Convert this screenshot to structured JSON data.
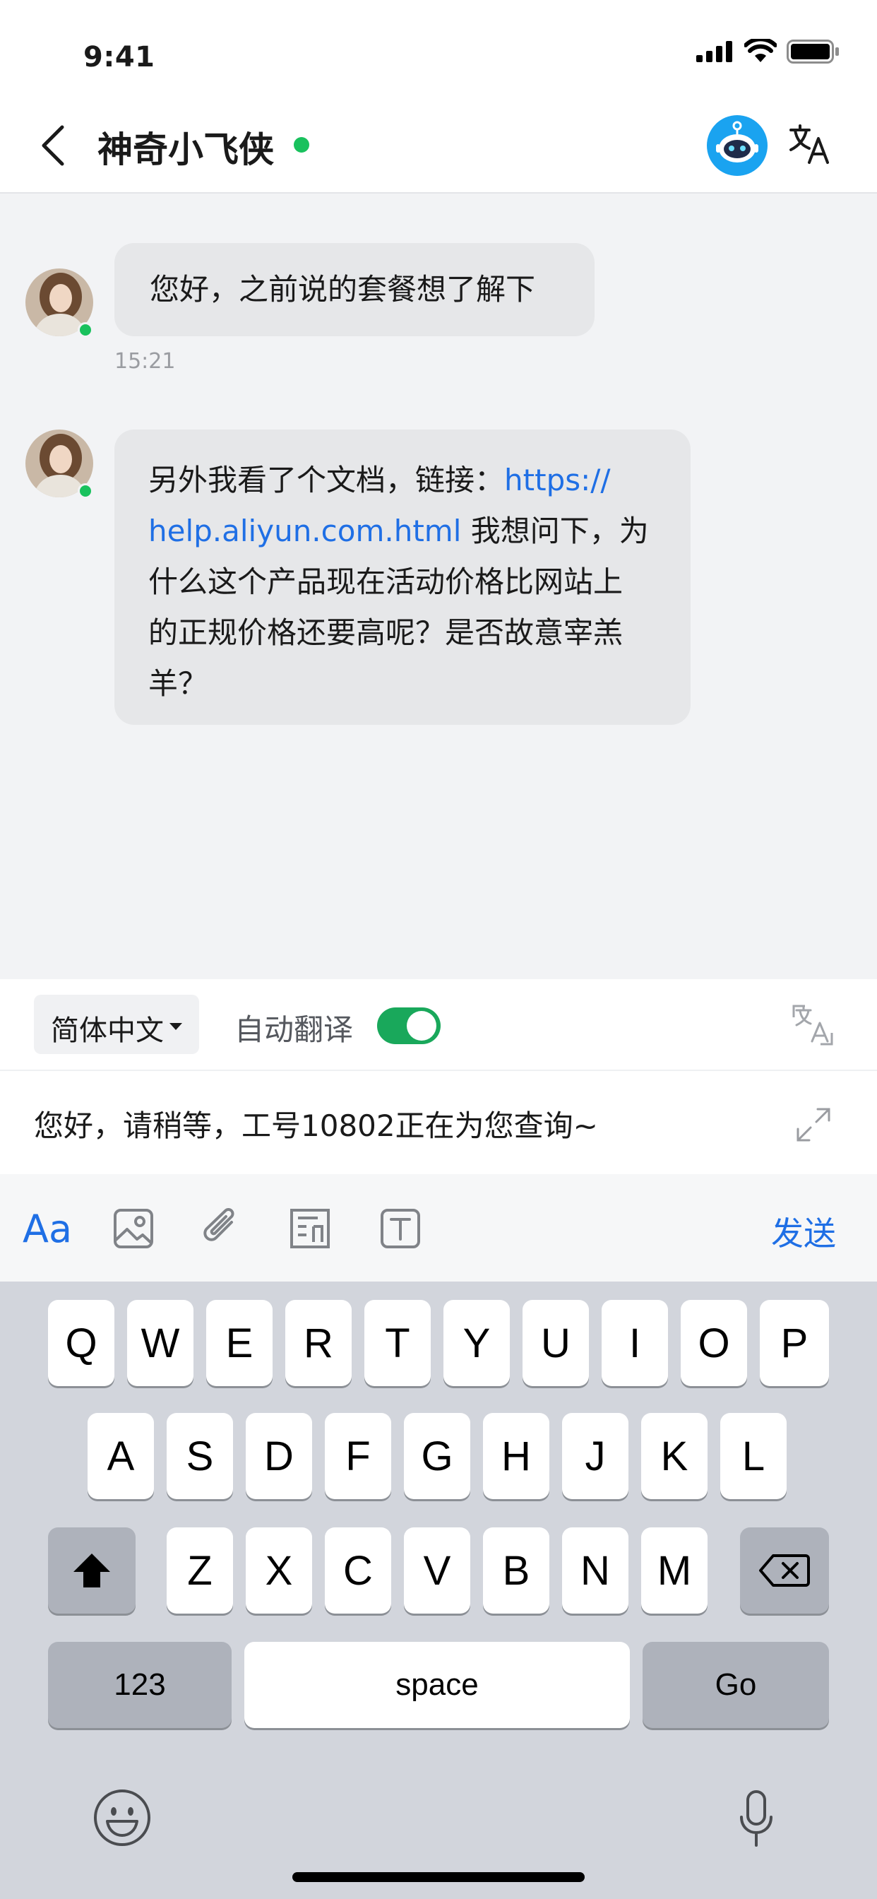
{
  "status_bar": {
    "time": "9:41"
  },
  "header": {
    "contact_name": "神奇小飞侠"
  },
  "messages": [
    {
      "text": "您好，之前说的套餐想了解下",
      "time": "15:21"
    },
    {
      "line1_text": "另外我看了个文档，链接：",
      "line1_link": "https://",
      "line2_link": "help.aliyun.com.html",
      "line2_text": " 我想问下，为",
      "line3": "什么这个产品现在活动价格比网站上",
      "line4": "的正规价格还要高呢？是否故意宰羔",
      "line5": "羊？"
    }
  ],
  "translate_bar": {
    "language": "简体中文",
    "auto_translate_label": "自动翻译",
    "auto_translate_on": true
  },
  "composer": {
    "value": "您好，请稍等，工号10802正在为您查询~"
  },
  "toolbar": {
    "font_label": "Aa",
    "send_label": "发送"
  },
  "keyboard": {
    "row1": [
      "Q",
      "W",
      "E",
      "R",
      "T",
      "Y",
      "U",
      "I",
      "O",
      "P"
    ],
    "row2": [
      "A",
      "S",
      "D",
      "F",
      "G",
      "H",
      "J",
      "K",
      "L"
    ],
    "row3": [
      "Z",
      "X",
      "C",
      "V",
      "B",
      "N",
      "M"
    ],
    "numbers_label": "123",
    "space_label": "space",
    "go_label": "Go"
  },
  "colors": {
    "accent": "#1f6fe5",
    "online": "#19c15d",
    "toggle_on": "#19a85b"
  }
}
